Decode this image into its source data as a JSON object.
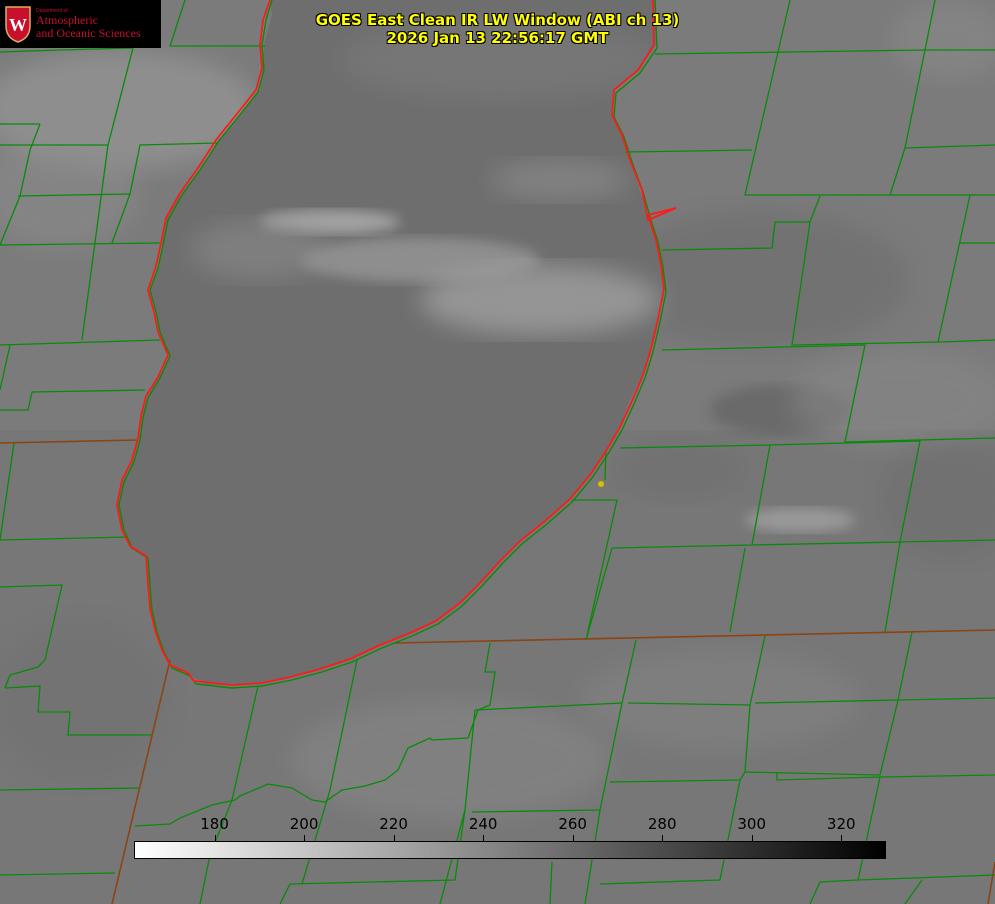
{
  "title": {
    "line1": "GOES East Clean IR LW Window (ABI ch 13)",
    "line2": "2026 Jan 13 22:56:17 GMT"
  },
  "logo": {
    "dept": "Department of",
    "line1": "Atmospheric",
    "line2": "and Oceanic Sciences",
    "crest_letter": "W",
    "crest_color": "#c8102e"
  },
  "colorbar": {
    "ticks": [
      180,
      200,
      220,
      240,
      260,
      280,
      300,
      320
    ],
    "range": [
      162,
      330
    ],
    "color_low": "#ffffff",
    "color_high": "#000000"
  },
  "colors": {
    "county_lines": "#0a8a0a",
    "shoreline": "#ff1a1a",
    "state_lines": "#8b4513",
    "marker": "#d4c000",
    "title_text": "#ffff00"
  }
}
